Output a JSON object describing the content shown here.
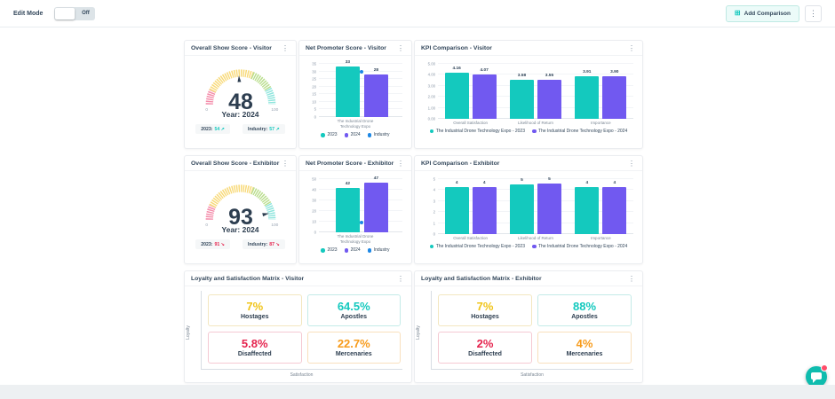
{
  "topbar": {
    "edit_mode_label": "Edit Mode",
    "toggle_state_label": "Off",
    "add_comparison_label": "Add Comparison",
    "add_comparison_icon": "⊞",
    "kebab_icon": "⋮"
  },
  "colors": {
    "teal": "#14c9be",
    "purple": "#7159f0",
    "blue": "#1e88e5",
    "navy": "#33475b",
    "gauge_pink": "#f48caa",
    "gauge_yellow": "#f8da7a",
    "gauge_green": "#bade8e",
    "gauge_teal": "#8fe5dd"
  },
  "cards": [
    {
      "type": "gauge",
      "title": "Overall Show Score - Visitor",
      "value": 48,
      "min_label": "0",
      "max_label": "100",
      "year_label": "Year: 2024",
      "badges": [
        {
          "label": "2023:",
          "value": "54",
          "arrow": "↗",
          "trend": "up"
        },
        {
          "label": "Industry:",
          "value": "57",
          "arrow": "↗",
          "trend": "up"
        }
      ]
    },
    {
      "type": "nps",
      "title": "Net Promoter Score - Visitor",
      "ymax": 35,
      "yticks": [
        35,
        30,
        25,
        20,
        15,
        10,
        5,
        0
      ],
      "bars": [
        {
          "name": "2023",
          "value": 33,
          "label": "33",
          "color": "teal"
        },
        {
          "name": "2024",
          "value": 28,
          "label": "28",
          "color": "purple"
        }
      ],
      "industry_value": 30,
      "x_label_lines": [
        "The Industrial Drone",
        "Technology Expo"
      ],
      "legend": [
        {
          "name": "2023",
          "color": "teal"
        },
        {
          "name": "2024",
          "color": "purple"
        },
        {
          "name": "Industry",
          "color": "blue"
        }
      ]
    },
    {
      "type": "kpi",
      "title": "KPI Comparison - Visitor",
      "ymax": 5,
      "yticks": [
        "5.00",
        "4.00",
        "3.00",
        "2.00",
        "1.00",
        "0.00"
      ],
      "ytick_values": [
        5,
        4,
        3,
        2,
        1,
        0
      ],
      "categories": [
        "Overall Satisfaction",
        "Likelihood of Return",
        "Importance"
      ],
      "series": [
        {
          "name": "The Industrial Drone Technology Expo - 2023",
          "color": "teal",
          "values": [
            4.16,
            3.58,
            3.91
          ],
          "labels": [
            "4.16",
            "3.58",
            "3.91"
          ]
        },
        {
          "name": "The Industrial Drone Technology Expo - 2024",
          "color": "purple",
          "values": [
            4.07,
            3.55,
            3.9
          ],
          "labels": [
            "4.07",
            "3.55",
            "3.90"
          ]
        }
      ]
    },
    {
      "type": "gauge",
      "title": "Overall Show Score - Exhibitor",
      "value": 93,
      "min_label": "0",
      "max_label": "100",
      "year_label": "Year: 2024",
      "badges": [
        {
          "label": "2023:",
          "value": "91",
          "arrow": "↘",
          "trend": "down"
        },
        {
          "label": "Industry:",
          "value": "87",
          "arrow": "↘",
          "trend": "down"
        }
      ]
    },
    {
      "type": "nps",
      "title": "Net Promoter Score - Exhibitor",
      "ymax": 50,
      "yticks": [
        50,
        40,
        30,
        20,
        10,
        0
      ],
      "bars": [
        {
          "name": "2023",
          "value": 42,
          "label": "42",
          "color": "teal"
        },
        {
          "name": "2024",
          "value": 47,
          "label": "47",
          "color": "purple"
        }
      ],
      "industry_value": 9,
      "x_label_lines": [
        "The Industrial Drone",
        "Technology Expo"
      ],
      "legend": [
        {
          "name": "2023",
          "color": "teal"
        },
        {
          "name": "2024",
          "color": "purple"
        },
        {
          "name": "Industry",
          "color": "blue"
        }
      ]
    },
    {
      "type": "kpi",
      "title": "KPI Comparison - Exhibitor",
      "ymax": 5,
      "yticks": [
        "5",
        "4",
        "3",
        "2",
        "1",
        "0"
      ],
      "ytick_values": [
        5,
        4,
        3,
        2,
        1,
        0
      ],
      "categories": [
        "Overall Satisfaction",
        "Likelihood of Return",
        "Importance"
      ],
      "series": [
        {
          "name": "The Industrial Drone Technology Expo - 2023",
          "color": "teal",
          "values": [
            4.28,
            4.55,
            4.25
          ],
          "labels": [
            "4",
            "5",
            "4"
          ]
        },
        {
          "name": "The Industrial Drone Technology Expo - 2024",
          "color": "purple",
          "values": [
            4.3,
            4.6,
            4.3
          ],
          "labels": [
            "4",
            "5",
            "4"
          ]
        }
      ]
    },
    {
      "type": "matrix",
      "title": "Loyalty and Satisfaction Matrix - Visitor",
      "ylabel": "Loyalty",
      "xlabel": "Satisfaction",
      "quadrants": [
        {
          "pct": "7%",
          "name": "Hostages",
          "color": "#f0c419",
          "border": "#f3e7c0"
        },
        {
          "pct": "64.5%",
          "name": "Apostles",
          "color": "#14c9be",
          "border": "#c4ebe8"
        },
        {
          "pct": "5.8%",
          "name": "Disaffected",
          "color": "#e5244e",
          "border": "#f5c9d3"
        },
        {
          "pct": "22.7%",
          "name": "Mercenaries",
          "color": "#f79b1b",
          "border": "#f9e0bd"
        }
      ]
    },
    {
      "type": "matrix",
      "title": "Loyalty and Satisfaction Matrix - Exhibitor",
      "ylabel": "Loyalty",
      "xlabel": "Satisfaction",
      "quadrants": [
        {
          "pct": "7%",
          "name": "Hostages",
          "color": "#f0c419",
          "border": "#f3e7c0"
        },
        {
          "pct": "88%",
          "name": "Apostles",
          "color": "#14c9be",
          "border": "#c4ebe8"
        },
        {
          "pct": "2%",
          "name": "Disaffected",
          "color": "#e5244e",
          "border": "#f5c9d3"
        },
        {
          "pct": "4%",
          "name": "Mercenaries",
          "color": "#f79b1b",
          "border": "#f9e0bd"
        }
      ]
    }
  ]
}
